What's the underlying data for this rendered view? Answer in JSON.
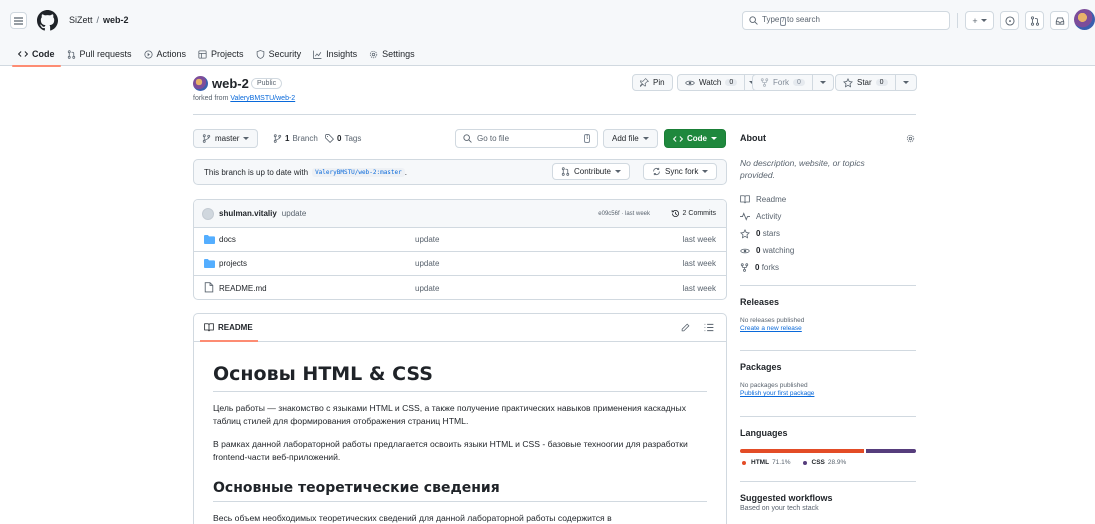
{
  "header": {
    "owner": "SiZett",
    "separator": "/",
    "repo": "web-2",
    "search_placeholder_pre": "Type",
    "search_key": "/",
    "search_placeholder_post": "to search",
    "plus_label": "+"
  },
  "nav": {
    "tabs": [
      {
        "label": "Code",
        "icon": "code-icon"
      },
      {
        "label": "Pull requests",
        "icon": "pull-request-icon"
      },
      {
        "label": "Actions",
        "icon": "play-icon"
      },
      {
        "label": "Projects",
        "icon": "table-icon"
      },
      {
        "label": "Security",
        "icon": "shield-icon"
      },
      {
        "label": "Insights",
        "icon": "graph-icon"
      },
      {
        "label": "Settings",
        "icon": "gear-icon"
      }
    ]
  },
  "repo": {
    "name": "web-2",
    "visibility": "Public",
    "forked_prefix": "forked from",
    "forked_from": "ValeryBMSTU/web-2",
    "pin_label": "Pin",
    "watch_label": "Watch",
    "watch_count": "0",
    "fork_label": "Fork",
    "fork_count": "0",
    "star_label": "Star",
    "star_count": "0"
  },
  "filenav": {
    "branch": "master",
    "branch_count": "1",
    "branch_label": "Branch",
    "tag_count": "0",
    "tag_label": "Tags",
    "go_to_file": "Go to file",
    "go_to_file_key": "t",
    "add_file": "Add file",
    "code_button": "Code"
  },
  "sync": {
    "text": "This branch is up to date with",
    "ref": "ValeryBMSTU/web-2:master",
    "suffix": ".",
    "contribute": "Contribute",
    "sync_fork": "Sync fork"
  },
  "commit": {
    "user": "shulman.vitaliy",
    "message": "update",
    "meta": "e09c56f · last week",
    "commits": "2 Commits"
  },
  "files": [
    {
      "name": "docs",
      "type": "folder",
      "message": "update",
      "date": "last week"
    },
    {
      "name": "projects",
      "type": "folder",
      "message": "update",
      "date": "last week"
    },
    {
      "name": "README.md",
      "type": "file",
      "message": "update",
      "date": "last week"
    }
  ],
  "readme": {
    "tab_label": "README",
    "h1": "Основы HTML & CSS",
    "p1": "Цель работы — знакомство с языками HTML и CSS, а также получение практических навыков применения каскадных таблиц стилей для формирования отображения страниц HTML.",
    "p2": "В рамках данной лабораторной работы предлагается освоить языки HTML и CSS - базовые техноогии для разработки frontend-части веб-приложений.",
    "h2": "Основные теоретические сведения",
    "p3": "Весь объем необходимых теоретических сведений для данной лабораторной работы содержится в"
  },
  "about": {
    "title": "About",
    "description": "No description, website, or topics provided.",
    "readme": "Readme",
    "activity": "Activity",
    "stars_count": "0",
    "stars_label": "stars",
    "watching_count": "0",
    "watching_label": "watching",
    "forks_count": "0",
    "forks_label": "forks"
  },
  "releases": {
    "title": "Releases",
    "none": "No releases published",
    "link": "Create a new release"
  },
  "packages": {
    "title": "Packages",
    "none": "No packages published",
    "link": "Publish your first package"
  },
  "languages": {
    "title": "Languages",
    "items": [
      {
        "name": "HTML",
        "percent": "71.1%",
        "color": "#e34c26",
        "value": 71.1
      },
      {
        "name": "CSS",
        "percent": "28.9%",
        "color": "#563d7c",
        "value": 28.9
      }
    ]
  },
  "workflows": {
    "title": "Suggested workflows",
    "subtitle": "Based on your tech stack"
  }
}
